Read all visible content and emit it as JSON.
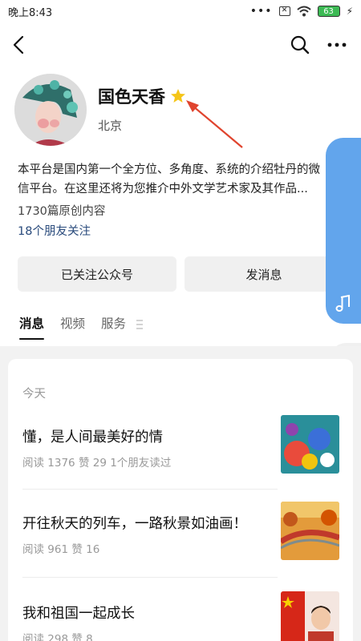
{
  "status_bar": {
    "time": "晚上8:43",
    "dots": "•••",
    "battery": "63"
  },
  "account": {
    "name": "国色天香",
    "location": "北京",
    "description": "本平台是国内第一个全方位、多角度、系统的介绍牡丹的微信平台。在这里还将为您推介中外文学艺术家及其作品...",
    "article_count": "1730篇原创内容",
    "friends_follow": "18个朋友关注"
  },
  "actions": {
    "followed_label": "已关注公众号",
    "message_label": "发消息"
  },
  "tabs": [
    {
      "label": "消息",
      "active": true
    },
    {
      "label": "视频",
      "active": false
    },
    {
      "label": "服务",
      "active": false
    }
  ],
  "feed": {
    "section_label": "今天",
    "articles": [
      {
        "title": "懂，是人间最美好的情",
        "meta": "阅读 1376   赞 29   1个朋友读过"
      },
      {
        "title": "开往秋天的列车，一路秋景如油画！",
        "meta": "阅读 961   赞 16"
      },
      {
        "title": "我和祖国一起成长",
        "meta": "阅读 298   赞 8"
      }
    ]
  },
  "colors": {
    "accent_link": "#2a4b7c",
    "side_panel": "#62a5ec",
    "star": "#f5c518",
    "annotation_arrow": "#e0442e"
  }
}
